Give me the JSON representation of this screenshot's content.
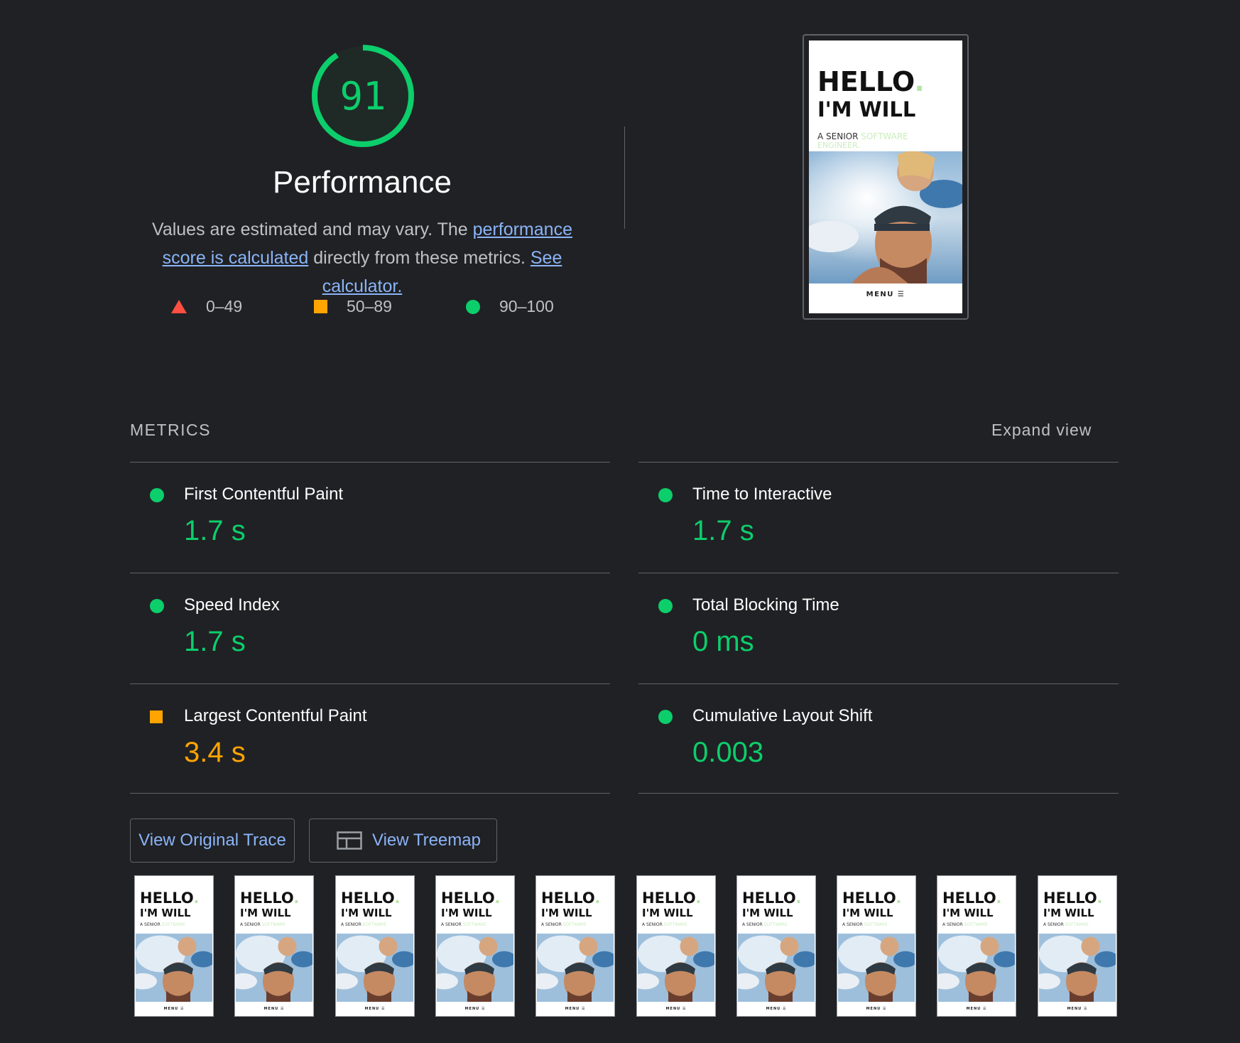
{
  "score": {
    "value": "91",
    "fraction": 0.91,
    "title": "Performance",
    "color": "#0cce6b"
  },
  "description": {
    "prefix": "Values are estimated and may vary. The ",
    "link1": "performance score is calculated",
    "middle": " directly from these metrics. ",
    "link2": "See calculator."
  },
  "legend": [
    {
      "icon": "triangle-icon",
      "label": "0–49",
      "color": "#ff4e42"
    },
    {
      "icon": "square-icon",
      "label": "50–89",
      "color": "#ffa400"
    },
    {
      "icon": "circle-icon",
      "label": "90–100",
      "color": "#0cce6b"
    }
  ],
  "final_screenshot": {
    "hello": "HELLO",
    "dot": ".",
    "name": "I'M WILL",
    "sub_prefix": "A SENIOR ",
    "sub_highlight": "SOFTWARE",
    "sub_line2": "ENGINEER.",
    "menu": "MENU ☰"
  },
  "metrics": {
    "header": "METRICS",
    "expand": "Expand view",
    "items": [
      {
        "title": "First Contentful Paint",
        "value": "1.7 s",
        "status": "pass"
      },
      {
        "title": "Time to Interactive",
        "value": "1.7 s",
        "status": "pass"
      },
      {
        "title": "Speed Index",
        "value": "1.7 s",
        "status": "pass"
      },
      {
        "title": "Total Blocking Time",
        "value": "0 ms",
        "status": "pass"
      },
      {
        "title": "Largest Contentful Paint",
        "value": "3.4 s",
        "status": "average"
      },
      {
        "title": "Cumulative Layout Shift",
        "value": "0.003",
        "status": "pass"
      }
    ]
  },
  "buttons": {
    "trace": "View Original Trace",
    "treemap": "View Treemap"
  },
  "filmstrip_frame_count": 10
}
